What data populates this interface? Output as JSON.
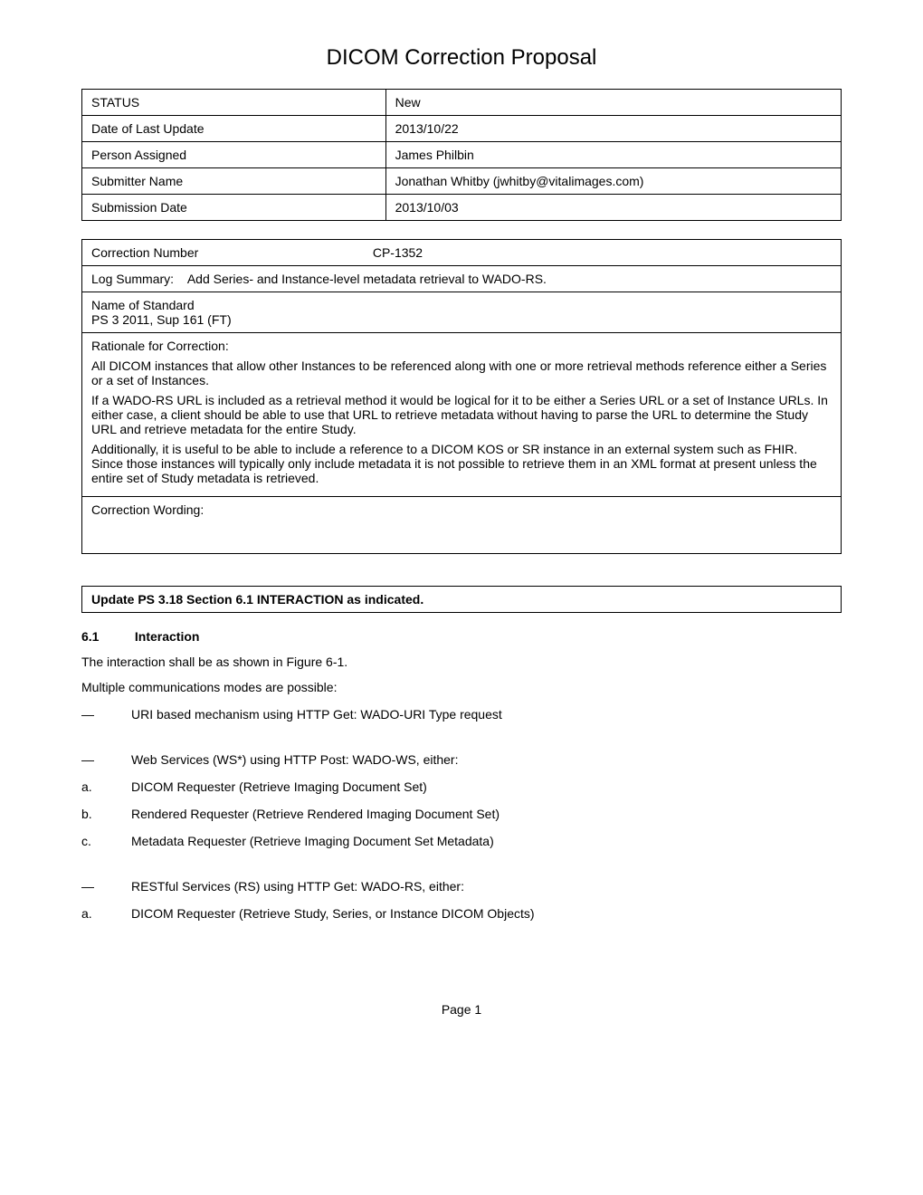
{
  "title": "DICOM Correction Proposal",
  "metaTable": [
    {
      "label": "STATUS",
      "value": "New"
    },
    {
      "label": "Date of Last Update",
      "value": "2013/10/22"
    },
    {
      "label": "Person Assigned",
      "value": "James Philbin"
    },
    {
      "label": "Submitter Name",
      "value": "Jonathan Whitby (jwhitby@vitalimages.com)"
    },
    {
      "label": "Submission Date",
      "value": "2013/10/03"
    }
  ],
  "correction": {
    "numberLabel": "Correction Number",
    "numberValue": "CP-1352",
    "logSummaryLabel": "Log Summary:",
    "logSummaryValue": "Add Series- and Instance-level metadata retrieval to WADO-RS.",
    "nameOfStandardLabel": "Name of Standard",
    "nameOfStandardValue": "PS 3 2011, Sup 161 (FT)",
    "rationaleLabel": "Rationale for Correction:",
    "rationaleParas": [
      "All DICOM instances that allow other Instances to be referenced along with one or more retrieval methods reference either a Series or a set of Instances.",
      "If a WADO-RS URL is included as a retrieval method it would be logical for it to be either a Series URL or a set of Instance URLs. In either case, a client should be able to use that URL to retrieve metadata without having to parse the URL to determine the Study URL and retrieve metadata for the entire Study.",
      "Additionally, it is useful to be able to include a reference to a DICOM KOS or SR instance in an external system such as FHIR. Since those instances will typically only include metadata it is not possible to retrieve them in an XML format at present unless the entire set of Study metadata is retrieved."
    ],
    "wordingLabel": "Correction Wording:"
  },
  "updateBox": "Update PS 3.18 Section 6.1 INTERACTION as indicated.",
  "section": {
    "num": "6.1",
    "title": "Interaction",
    "p1": "The interaction shall be as shown in Figure 6-1.",
    "p2": "Multiple communications modes are possible:",
    "list": [
      {
        "marker": "—",
        "text": "URI based mechanism using HTTP Get: WADO-URI Type request"
      },
      {
        "marker": "—",
        "text": "Web Services (WS*) using HTTP Post: WADO-WS, either:"
      },
      {
        "marker": "a.",
        "text": "DICOM Requester (Retrieve Imaging Document Set)"
      },
      {
        "marker": "b.",
        "text": "Rendered Requester (Retrieve Rendered Imaging Document Set)"
      },
      {
        "marker": "c.",
        "text": "Metadata Requester (Retrieve Imaging Document Set Metadata)"
      },
      {
        "marker": "—",
        "text": "RESTful Services (RS) using HTTP Get: WADO-RS, either:"
      },
      {
        "marker": "a.",
        "text": "DICOM Requester (Retrieve Study, Series, or Instance DICOM Objects)"
      }
    ],
    "gapsBefore": [
      0,
      1,
      5
    ]
  },
  "pageNumber": "Page 1"
}
